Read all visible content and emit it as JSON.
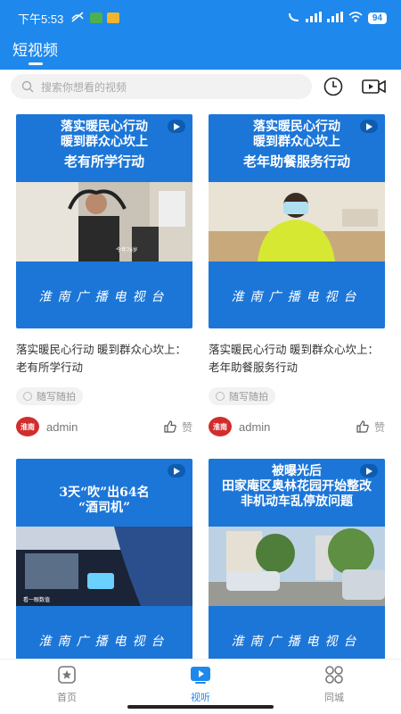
{
  "status": {
    "time": "下午5:53",
    "battery": "94"
  },
  "header": {
    "title": "短视频"
  },
  "search": {
    "placeholder": "搜索你想看的视频"
  },
  "colors": {
    "accent": "#1e88ec",
    "thumb_bg": "#1c76d8"
  },
  "cards": [
    {
      "head_line1": "落实暖民心行动",
      "head_line2": "暖到群众心坎上",
      "head_line3": "老有所学行动",
      "watermark": "今年76岁",
      "footer": "淮南广播电视台",
      "title": "落实暖民心行动 暖到群众心坎上：老有所学行动",
      "tag": "随写随拍",
      "avatar_text": "淮南",
      "author": "admin",
      "like": "赞"
    },
    {
      "head_line1": "落实暖民心行动",
      "head_line2": "暖到群众心坎上",
      "head_line3": "老年助餐服务行动",
      "watermark": "",
      "footer": "淮南广播电视台",
      "title": "落实暖民心行动 暖到群众心坎上：老年助餐服务行动",
      "tag": "随写随拍",
      "avatar_text": "淮南",
      "author": "admin",
      "like": "赞"
    },
    {
      "head_line1": "3天“吹”出64名",
      "head_line2": "“酒司机”",
      "head_line3": "",
      "watermark": "看一眼数值",
      "footer": "淮南广播电视台"
    },
    {
      "head_line1": "被曝光后",
      "head_line2": "田家庵区奥林花园开始整改",
      "head_line3": "非机动车乱停放问题",
      "watermark": "",
      "footer": "淮南广播电视台"
    }
  ],
  "tabs": [
    {
      "label": "首页",
      "icon": "star-home-icon"
    },
    {
      "label": "视听",
      "icon": "play-tv-icon"
    },
    {
      "label": "同城",
      "icon": "grid-apps-icon"
    }
  ]
}
